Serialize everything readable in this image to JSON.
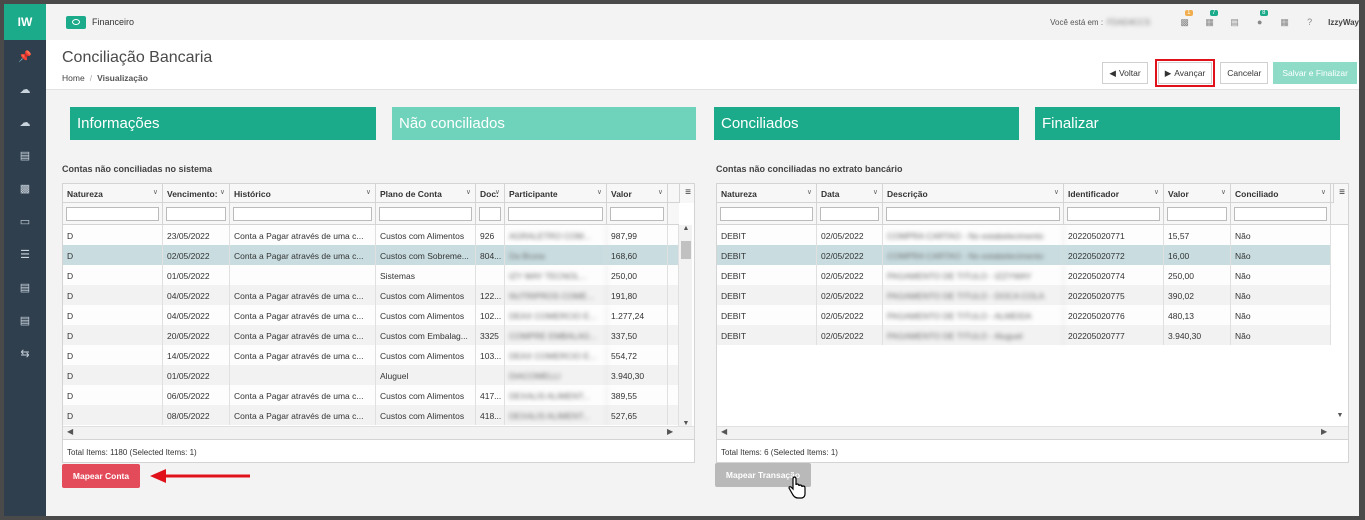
{
  "sidebar": {
    "logo": "IW",
    "icons": [
      "pin-icon",
      "cloud-upload-icon",
      "cloud-upload-icon",
      "credit-card-icon",
      "bar-chart-icon",
      "book-icon",
      "list-icon",
      "credit-card-icon",
      "document-icon",
      "swap-icon"
    ]
  },
  "topbar": {
    "app_name": "Financeiro",
    "location_label": "Você está em :",
    "location_value": "FDAD4CCS",
    "user": "IzzyWay",
    "badges": {
      "tasks": "1",
      "grid": "7",
      "bell": "8"
    },
    "badge_colors": {
      "tasks": "#f0ad4e",
      "grid": "#1cab8a",
      "bell": "#1cab8a"
    }
  },
  "page": {
    "title": "Conciliação Bancaria",
    "breadcrumb_home": "Home",
    "breadcrumb_current": "Visualização"
  },
  "actions": {
    "voltar": "Voltar",
    "avancar": "Avançar",
    "cancelar": "Cancelar",
    "salvar": "Salvar e Finalizar"
  },
  "steps": [
    "Informações",
    "Não conciliados",
    "Conciliados",
    "Finalizar"
  ],
  "left_grid": {
    "title": "Contas não conciliadas no sistema",
    "columns": [
      "Natureza",
      "Vencimento:",
      "Histórico",
      "Plano de Conta",
      "Doc:",
      "Participante",
      "Valor"
    ],
    "rows": [
      [
        "D",
        "23/05/2022",
        "Conta a Pagar através de uma c...",
        "Custos com Alimentos",
        "926",
        "AGRALETRO COM...",
        "987,99"
      ],
      [
        "D",
        "02/05/2022",
        "Conta a Pagar através de uma c...",
        "Custos com Sobreme...",
        "804...",
        "Da Bruna",
        "168,60"
      ],
      [
        "D",
        "01/05/2022",
        "",
        "Sistemas",
        "",
        "IZY WAY TECNOL...",
        "250,00"
      ],
      [
        "D",
        "04/05/2022",
        "Conta a Pagar através de uma c...",
        "Custos com Alimentos",
        "122...",
        "NUTRIPROS COME...",
        "191,80"
      ],
      [
        "D",
        "04/05/2022",
        "Conta a Pagar através de uma c...",
        "Custos com Alimentos",
        "102...",
        "DEAX COMERCIO E...",
        "1.277,24"
      ],
      [
        "D",
        "20/05/2022",
        "Conta a Pagar através de uma c...",
        "Custos com Embalag...",
        "3325",
        "COMPRE EMBALAG...",
        "337,50"
      ],
      [
        "D",
        "14/05/2022",
        "Conta a Pagar através de uma c...",
        "Custos com Alimentos",
        "103...",
        "DEAX COMERCIO E...",
        "554,72"
      ],
      [
        "D",
        "01/05/2022",
        "",
        "Aluguel",
        "",
        "DIACOMELLI",
        "3.940,30"
      ],
      [
        "D",
        "06/05/2022",
        "Conta a Pagar através de uma c...",
        "Custos com Alimentos",
        "417...",
        "DEXALIS ALIMENT...",
        "389,55"
      ],
      [
        "D",
        "08/05/2022",
        "Conta a Pagar através de uma c...",
        "Custos com Alimentos",
        "418...",
        "DEXALIS ALIMENT...",
        "527,65"
      ]
    ],
    "footer": "Total Items: 1180 (Selected Items: 1)",
    "button": "Mapear Conta"
  },
  "right_grid": {
    "title": "Contas não conciliadas no extrato bancário",
    "columns": [
      "Natureza",
      "Data",
      "Descrição",
      "Identificador",
      "Valor",
      "Conciliado"
    ],
    "rows": [
      [
        "DEBIT",
        "02/05/2022",
        "COMPRA CARTAO - No estabelecimento",
        "202205020771",
        "15,57",
        "Não"
      ],
      [
        "DEBIT",
        "02/05/2022",
        "COMPRA CARTAO - No estabelecimento",
        "202205020772",
        "16,00",
        "Não"
      ],
      [
        "DEBIT",
        "02/05/2022",
        "PAGAMENTO DE TITULO - IZZYWAY",
        "202205020774",
        "250,00",
        "Não"
      ],
      [
        "DEBIT",
        "02/05/2022",
        "PAGAMENTO DE TITULO - DOCA COLA",
        "202205020775",
        "390,02",
        "Não"
      ],
      [
        "DEBIT",
        "02/05/2022",
        "PAGAMENTO DE TITULO - ALMEIDA",
        "202205020776",
        "480,13",
        "Não"
      ],
      [
        "DEBIT",
        "02/05/2022",
        "PAGAMENTO DE TITULO - Aluguel",
        "202205020777",
        "3.940,30",
        "Não"
      ]
    ],
    "footer": "Total Items: 6 (Selected Items: 1)",
    "button": "Mapear Transação"
  }
}
